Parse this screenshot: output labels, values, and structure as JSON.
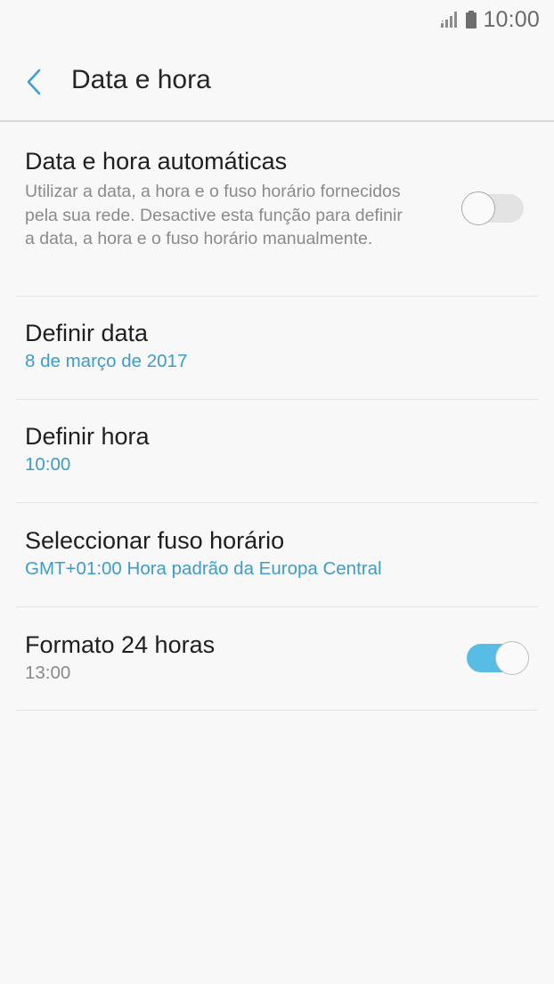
{
  "status_bar": {
    "time": "10:00",
    "icons": [
      "signal-icon",
      "battery-icon"
    ]
  },
  "app_bar": {
    "title": "Data e hora",
    "back_icon": "chevron-left-icon"
  },
  "settings": {
    "auto_datetime": {
      "title": "Data e hora automáticas",
      "description": "Utilizar a data, a hora e o fuso horário fornecidos pela sua rede. Desactive esta função para definir a data, a hora e o fuso horário manualmente.",
      "enabled": false
    },
    "set_date": {
      "title": "Definir data",
      "value": "8 de março de 2017"
    },
    "set_time": {
      "title": "Definir hora",
      "value": "10:00"
    },
    "time_zone": {
      "title": "Seleccionar fuso horário",
      "value": "GMT+01:00 Hora padrão da Europa Central"
    },
    "format_24h": {
      "title": "Formato 24 horas",
      "value": "13:00",
      "enabled": true
    }
  },
  "colors": {
    "accent": "#3e9cc9",
    "switch_on": "#58bde5",
    "switch_off": "#e3e3e3",
    "background": "#f8f8f8"
  }
}
